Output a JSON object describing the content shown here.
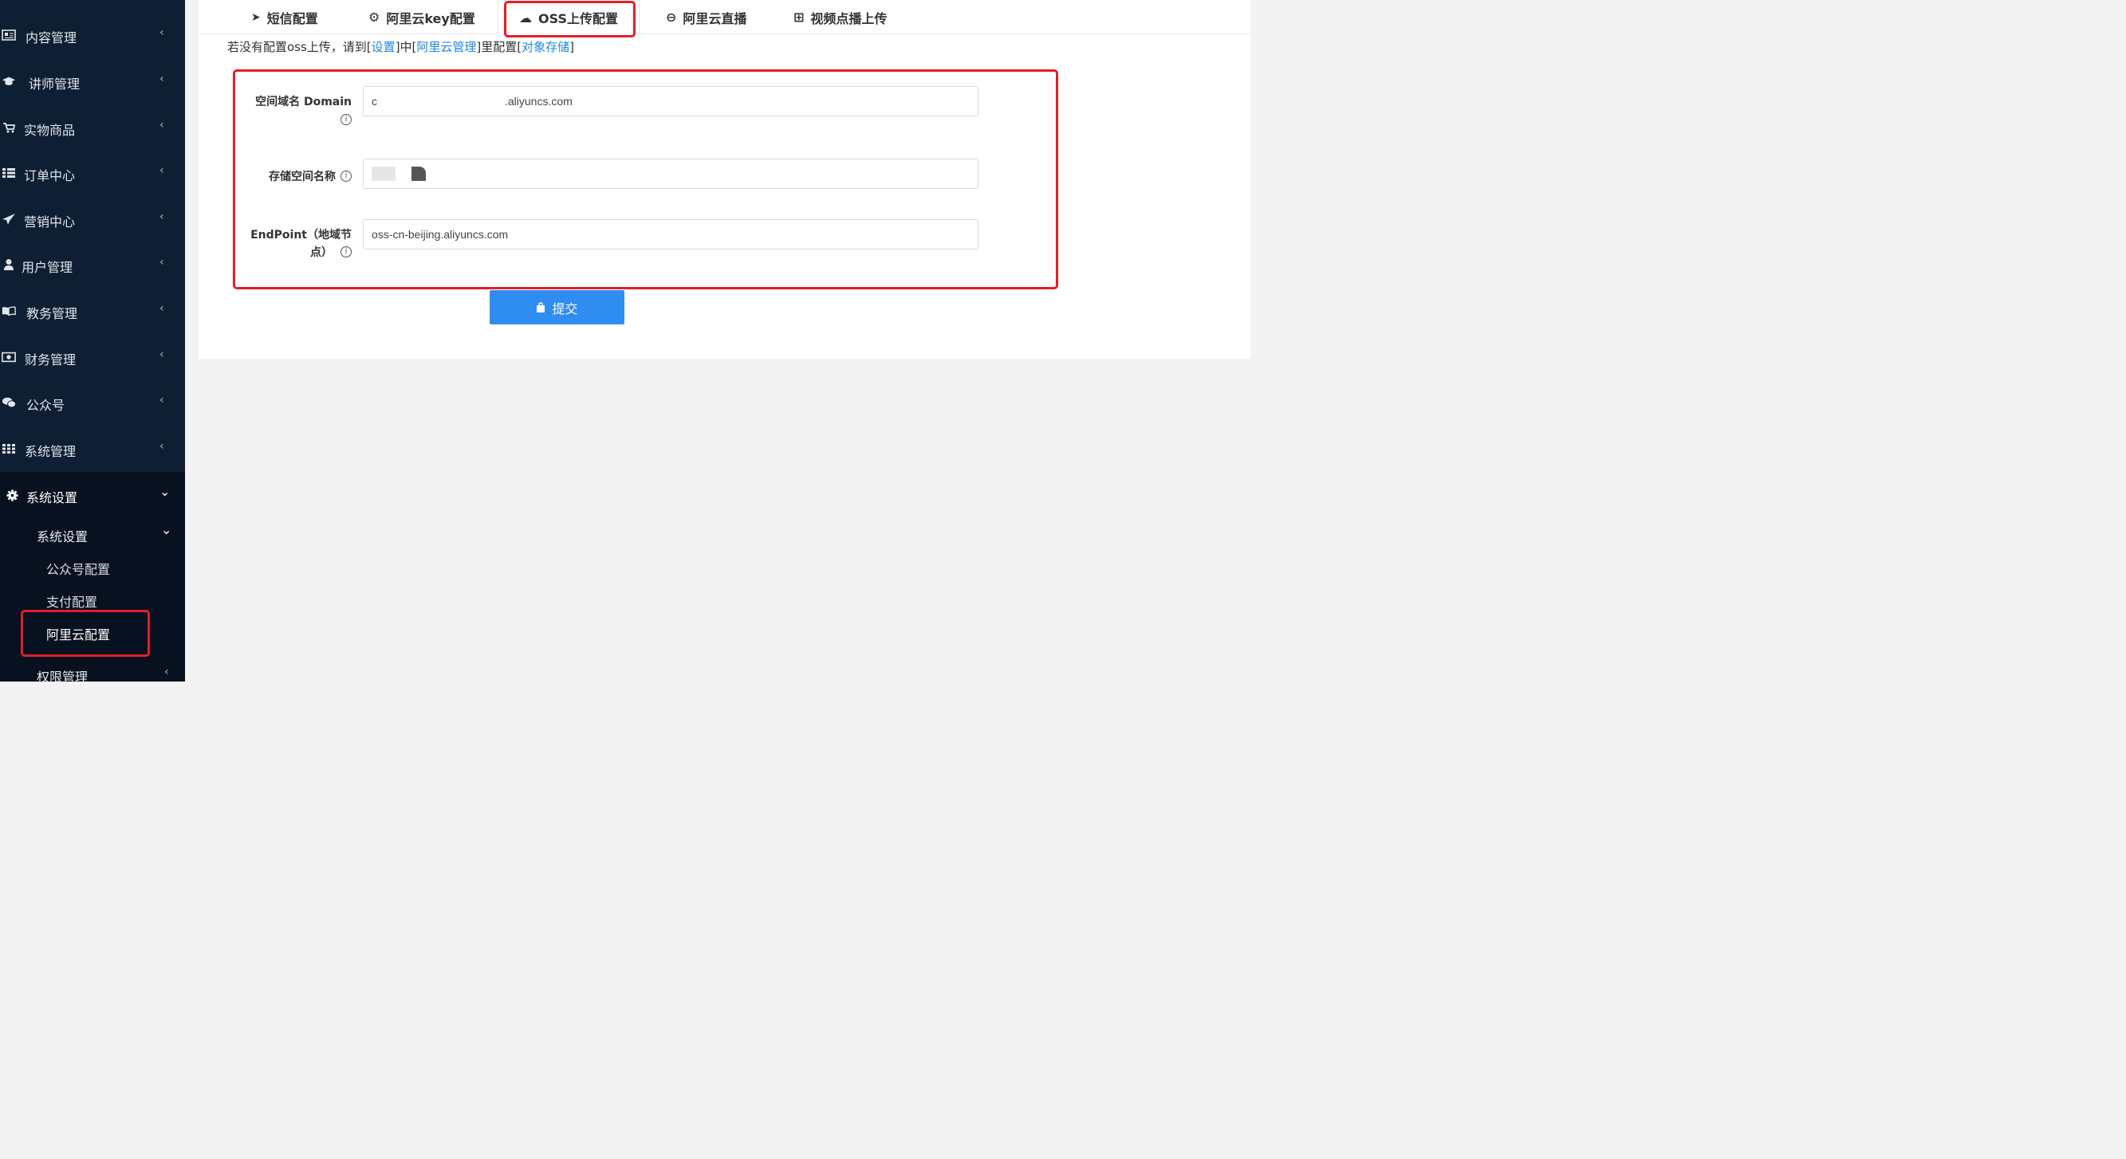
{
  "sidebar": {
    "items": [
      {
        "label": "内容管理",
        "icon": "newspaper-icon"
      },
      {
        "label": "讲师管理",
        "icon": "graduation-cap-icon"
      },
      {
        "label": "实物商品",
        "icon": "cart-icon"
      },
      {
        "label": "订单中心",
        "icon": "list-icon"
      },
      {
        "label": "营销中心",
        "icon": "paper-plane-icon"
      },
      {
        "label": "用户管理",
        "icon": "user-icon"
      },
      {
        "label": "教务管理",
        "icon": "book-icon"
      },
      {
        "label": "财务管理",
        "icon": "money-icon"
      },
      {
        "label": "公众号",
        "icon": "wechat-icon"
      },
      {
        "label": "系统管理",
        "icon": "grid-icon"
      },
      {
        "label": "系统设置",
        "icon": "gear-icon"
      }
    ],
    "sub_group": "系统设置",
    "sub_items": [
      "公众号配置",
      "支付配置",
      "阿里云配置"
    ],
    "next_group": "权限管理",
    "chev_right": "‹",
    "chev_down": "⌄"
  },
  "tabs": [
    {
      "label": "短信配置",
      "icon": "send-icon",
      "glyph": "➤"
    },
    {
      "label": "阿里云key配置",
      "icon": "gear-icon",
      "glyph": "⚙"
    },
    {
      "label": "OSS上传配置",
      "icon": "cloud-upload-icon",
      "glyph": "☁"
    },
    {
      "label": "阿里云直播",
      "icon": "arrow-circle-icon",
      "glyph": "⊖"
    },
    {
      "label": "视频点播上传",
      "icon": "plus-square-icon",
      "glyph": "⊞"
    }
  ],
  "hint": {
    "before": "若没有配置oss上传，请到[",
    "link1": "设置",
    "mid1": "]中[",
    "link2": "阿里云管理",
    "mid2": "]里配置[",
    "link3": "对象存储",
    "after": "]"
  },
  "form": {
    "domain_label": "空间域名 Domain",
    "domain_value_prefix": "c",
    "domain_value_suffix": ".aliyuncs.com",
    "bucket_label": "存储空间名称",
    "endpoint_label_line1": "EndPoint（地域节",
    "endpoint_label_line2": "点）",
    "endpoint_value": "oss-cn-beijing.aliyuncs.com",
    "info_glyph": "i"
  },
  "submit_label": "提交",
  "colors": {
    "accent": "#2f8cf0",
    "highlight": "#e41e26",
    "sidebar": "#0f1f33"
  }
}
